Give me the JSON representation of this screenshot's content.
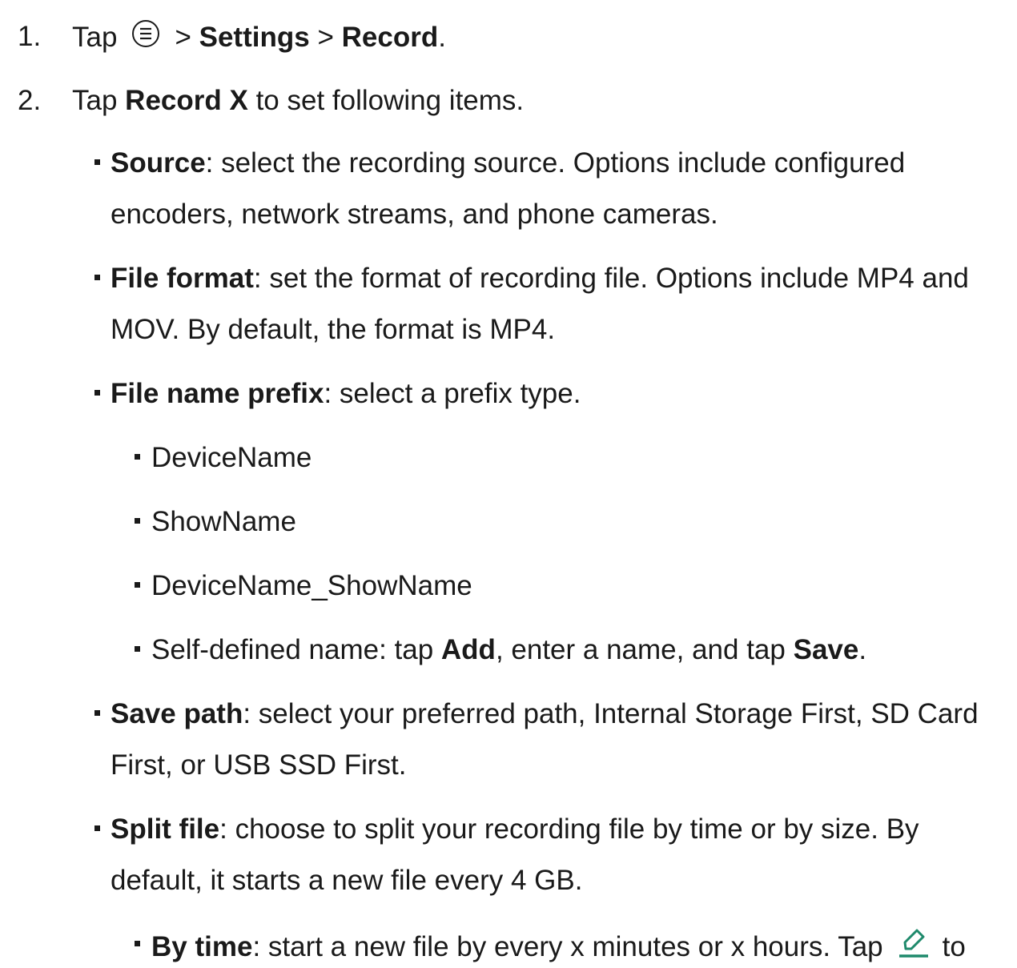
{
  "steps": [
    {
      "number": "1.",
      "prefix": "Tap",
      "icon": "menu-circle-icon",
      "sep1": ">",
      "settings": "Settings",
      "sep2": ">",
      "record": "Record",
      "end": "."
    },
    {
      "number": "2.",
      "prefix": "Tap",
      "bold": "Record X",
      "suffix": "to set following items."
    }
  ],
  "items": {
    "source": {
      "term": "Source",
      "line1": ": select the recording source. Options include configured",
      "line2": "encoders, network streams, and phone cameras."
    },
    "file_format": {
      "term": "File format",
      "line1": ": set the format of recording file. Options include MP4 and",
      "line2": "MOV. By default, the format is MP4."
    },
    "file_name_prefix": {
      "term": "File name prefix",
      "line1": ": select a prefix type.",
      "options": [
        "DeviceName",
        "ShowName",
        "DeviceName_ShowName"
      ],
      "self_defined": {
        "a": "Self-defined name: tap",
        "add": "Add",
        "b": ", enter a name, and tap",
        "save": "Save",
        "c": "."
      }
    },
    "save_path": {
      "term": "Save path",
      "line1": ": select your preferred path, Internal Storage First, SD Card",
      "line2": "First, or USB SSD First."
    },
    "split_file": {
      "term": "Split file",
      "line1": ": choose to split your recording file by time or by size. By",
      "line2": "default, it starts a new file every 4 GB.",
      "by_time": {
        "term": "By time",
        "text": ": start a new file by every x minutes or x hours. Tap",
        "icon": "edit-pencil-icon",
        "tail": "to"
      }
    }
  },
  "colors": {
    "text": "#1a1a1a",
    "edit_icon": "#1f8a6c"
  }
}
